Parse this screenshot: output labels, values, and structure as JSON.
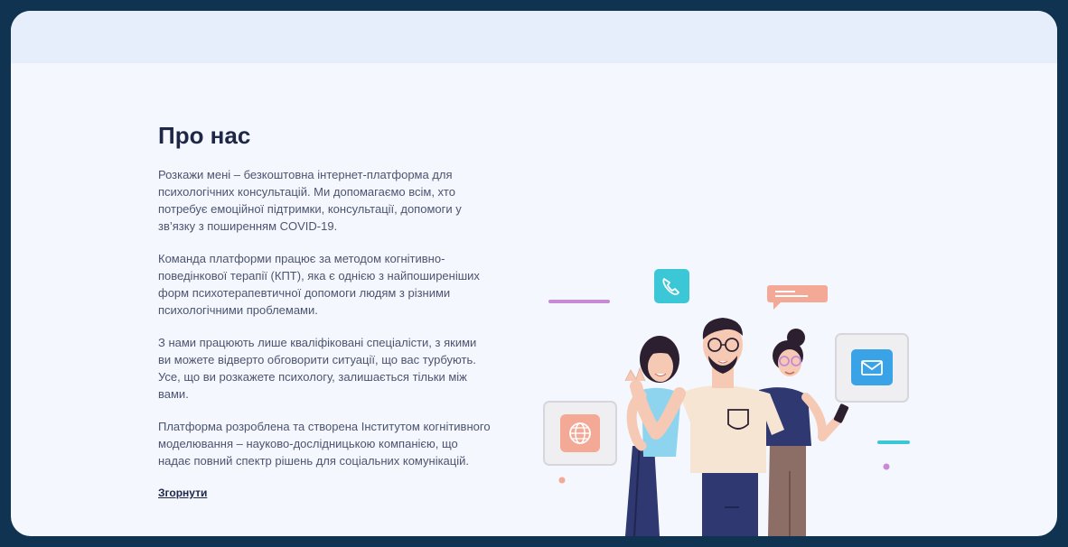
{
  "about": {
    "title": "Про нас",
    "paragraphs": [
      "Розкажи мені – безкоштовна інтернет-платформа для психологічних консультацій. Ми допомагаємо всім, хто потребує емоційної підтримки, консультації, допомоги у зв’язку з поширенням COVID-19.",
      "Команда платформи працює за методом когнітивно-поведінкової терапії (КПТ), яка є однією з найпоширеніших форм психотерапевтичної допомоги людям з різними психологічними проблемами.",
      "З нами працюють лише кваліфіковані спеціалісти, з якими ви можете відверто обговорити ситуації, що вас турбують. Усе, що ви розкажете психологу, залишається тільки між вами.",
      "Платформа розроблена та створена Інститутом когнітивного моделювання – науково-дослідницькою компанією, що надає повний спектр рішень для соціальних комунікацій."
    ],
    "collapse_label": "Згорнути"
  },
  "illustration": {
    "icons": [
      "phone-icon",
      "chat-bubble-icon",
      "globe-icon",
      "mail-icon"
    ],
    "colors": {
      "teal": "#3cc7d6",
      "salmon": "#f4a896",
      "blue": "#3aa3e8",
      "purple": "#c78ad6",
      "navy": "#2f3870",
      "cream": "#f6e5d3",
      "brown": "#8c6e66",
      "dark_hair": "#2c2030"
    }
  }
}
